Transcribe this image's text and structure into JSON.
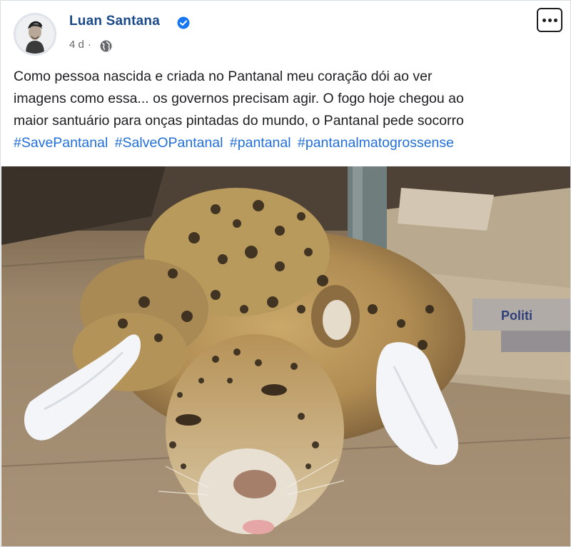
{
  "author": {
    "name": "Luan Santana",
    "verified": true
  },
  "meta": {
    "time": "4 d",
    "separator": "·",
    "audience_icon": "globe-icon"
  },
  "more_icon": "more-options-icon",
  "post": {
    "lines": [
      "Como pessoa nascida e criada no Pantanal meu coração dói ao ver",
      "imagens como essa... os governos precisam agir. O fogo hoje chegou ao",
      "maior santuário para onças pintadas do mundo, o Pantanal pede socorro"
    ],
    "hashtags": [
      "#SavePantanal",
      "#SalveOPantanal",
      "#pantanal",
      "#pantanalmatogrossense"
    ]
  },
  "photo": {
    "box_text": "Politi"
  },
  "colors": {
    "name": "#1b4a8a",
    "link": "#216fdb",
    "meta": "#65676b",
    "verified": "#1877f2"
  }
}
